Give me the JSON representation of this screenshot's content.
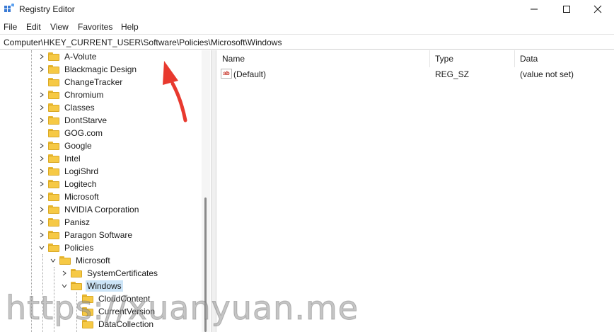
{
  "window": {
    "title": "Registry Editor"
  },
  "menu": [
    "File",
    "Edit",
    "View",
    "Favorites",
    "Help"
  ],
  "address": {
    "path": "Computer\\HKEY_CURRENT_USER\\Software\\Policies\\Microsoft\\Windows"
  },
  "tree": [
    {
      "label": "A-Volute",
      "expanded": false,
      "has_children": true
    },
    {
      "label": "Blackmagic Design",
      "expanded": false,
      "has_children": true
    },
    {
      "label": "ChangeTracker",
      "expanded": false,
      "has_children": false
    },
    {
      "label": "Chromium",
      "expanded": false,
      "has_children": true
    },
    {
      "label": "Classes",
      "expanded": false,
      "has_children": true
    },
    {
      "label": "DontStarve",
      "expanded": false,
      "has_children": true
    },
    {
      "label": "GOG.com",
      "expanded": false,
      "has_children": false
    },
    {
      "label": "Google",
      "expanded": false,
      "has_children": true
    },
    {
      "label": "Intel",
      "expanded": false,
      "has_children": true
    },
    {
      "label": "LogiShrd",
      "expanded": false,
      "has_children": true
    },
    {
      "label": "Logitech",
      "expanded": false,
      "has_children": true
    },
    {
      "label": "Microsoft",
      "expanded": false,
      "has_children": true
    },
    {
      "label": "NVIDIA Corporation",
      "expanded": false,
      "has_children": true
    },
    {
      "label": "Panisz",
      "expanded": false,
      "has_children": true
    },
    {
      "label": "Paragon Software",
      "expanded": false,
      "has_children": true
    },
    {
      "label": "Policies",
      "expanded": true,
      "has_children": true
    },
    {
      "label": "Microsoft",
      "expanded": true,
      "has_children": true
    },
    {
      "label": "SystemCertificates",
      "expanded": false,
      "has_children": true
    },
    {
      "label": "Windows",
      "expanded": true,
      "has_children": true,
      "selected": true
    },
    {
      "label": "CloudContent",
      "expanded": false,
      "has_children": false
    },
    {
      "label": "CurrentVersion",
      "expanded": false,
      "has_children": false
    },
    {
      "label": "DataCollection",
      "expanded": false,
      "has_children": false
    }
  ],
  "list": {
    "columns": [
      "Name",
      "Type",
      "Data"
    ],
    "rows": [
      {
        "name": "(Default)",
        "type": "REG_SZ",
        "data": "(value not set)",
        "icon": "string-value-icon"
      }
    ]
  },
  "watermark": "https://xuanyuan.me",
  "colors": {
    "selection": "#cce4f7",
    "folder": "#f6c945",
    "arrow": "#e8392e"
  }
}
